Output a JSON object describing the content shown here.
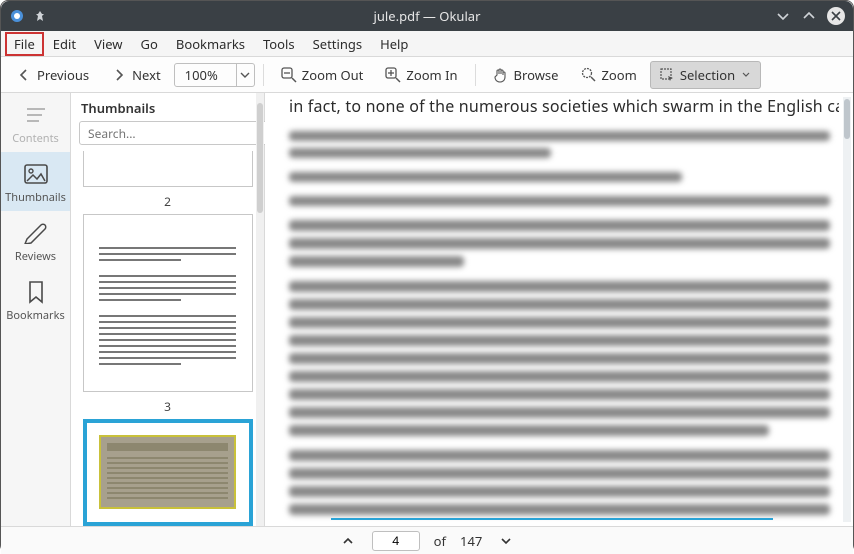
{
  "window": {
    "title": "jule.pdf — Okular"
  },
  "menu": {
    "file": "File",
    "edit": "Edit",
    "view": "View",
    "go": "Go",
    "bookmarks": "Bookmarks",
    "tools": "Tools",
    "settings": "Settings",
    "help": "Help"
  },
  "toolbar": {
    "previous": "Previous",
    "next": "Next",
    "zoom_value": "100%",
    "zoom_out": "Zoom Out",
    "zoom_in": "Zoom In",
    "browse": "Browse",
    "zoom": "Zoom",
    "selection": "Selection"
  },
  "sidebar": {
    "contents": "Contents",
    "thumbnails": "Thumbnails",
    "reviews": "Reviews",
    "bookmarks": "Bookmarks"
  },
  "thumbnails": {
    "header": "Thumbnails",
    "search_placeholder": "Search...",
    "pages": {
      "p2": "2",
      "p3": "3"
    },
    "current_page_index": 4
  },
  "document": {
    "visible_line": "in fact, to none of the numerous societies which swarm in the English capital,"
  },
  "pagebar": {
    "current": "4",
    "of_label": "of",
    "total": "147"
  }
}
